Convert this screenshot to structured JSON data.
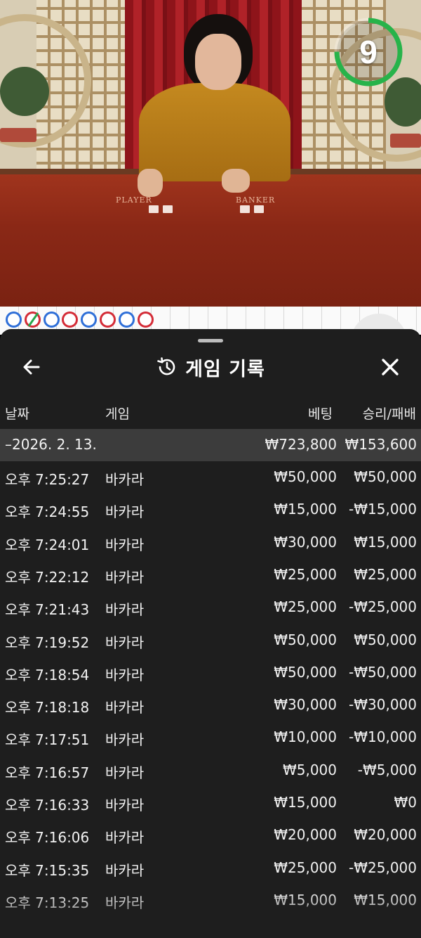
{
  "timer": {
    "value": "9",
    "fraction_remaining": 0.75,
    "color": "#27b34a"
  },
  "table": {
    "player_label": "PLAYER",
    "banker_label": "BANKER"
  },
  "bead_road": [
    {
      "color": "blue",
      "slashed": false
    },
    {
      "color": "red",
      "slashed": true
    },
    {
      "color": "blue",
      "slashed": false
    },
    {
      "color": "red",
      "slashed": false
    },
    {
      "color": "blue",
      "slashed": false
    },
    {
      "color": "red",
      "slashed": false
    },
    {
      "color": "blue",
      "slashed": false
    },
    {
      "color": "red",
      "slashed": false
    }
  ],
  "history": {
    "title": "게임 기록",
    "columns": {
      "date": "날짜",
      "game": "게임",
      "bet": "베팅",
      "result": "승리/패배"
    },
    "date_group": {
      "date": "–2026. 2. 13.",
      "total_bet": "₩723,800",
      "total_result": "₩153,600"
    },
    "rows": [
      {
        "time": "오후 7:25:27",
        "game": "바카라",
        "bet": "₩50,000",
        "result": "₩50,000"
      },
      {
        "time": "오후 7:24:55",
        "game": "바카라",
        "bet": "₩15,000",
        "result": "-₩15,000"
      },
      {
        "time": "오후 7:24:01",
        "game": "바카라",
        "bet": "₩30,000",
        "result": "₩15,000"
      },
      {
        "time": "오후 7:22:12",
        "game": "바카라",
        "bet": "₩25,000",
        "result": "₩25,000"
      },
      {
        "time": "오후 7:21:43",
        "game": "바카라",
        "bet": "₩25,000",
        "result": "-₩25,000"
      },
      {
        "time": "오후 7:19:52",
        "game": "바카라",
        "bet": "₩50,000",
        "result": "₩50,000"
      },
      {
        "time": "오후 7:18:54",
        "game": "바카라",
        "bet": "₩50,000",
        "result": "-₩50,000"
      },
      {
        "time": "오후 7:18:18",
        "game": "바카라",
        "bet": "₩30,000",
        "result": "-₩30,000"
      },
      {
        "time": "오후 7:17:51",
        "game": "바카라",
        "bet": "₩10,000",
        "result": "-₩10,000"
      },
      {
        "time": "오후 7:16:57",
        "game": "바카라",
        "bet": "₩5,000",
        "result": "-₩5,000"
      },
      {
        "time": "오후 7:16:33",
        "game": "바카라",
        "bet": "₩15,000",
        "result": "₩0"
      },
      {
        "time": "오후 7:16:06",
        "game": "바카라",
        "bet": "₩20,000",
        "result": "₩20,000"
      },
      {
        "time": "오후 7:15:35",
        "game": "바카라",
        "bet": "₩25,000",
        "result": "-₩25,000"
      },
      {
        "time": "오후 7:13:25",
        "game": "바카라",
        "bet": "₩15,000",
        "result": "₩15,000"
      }
    ]
  }
}
